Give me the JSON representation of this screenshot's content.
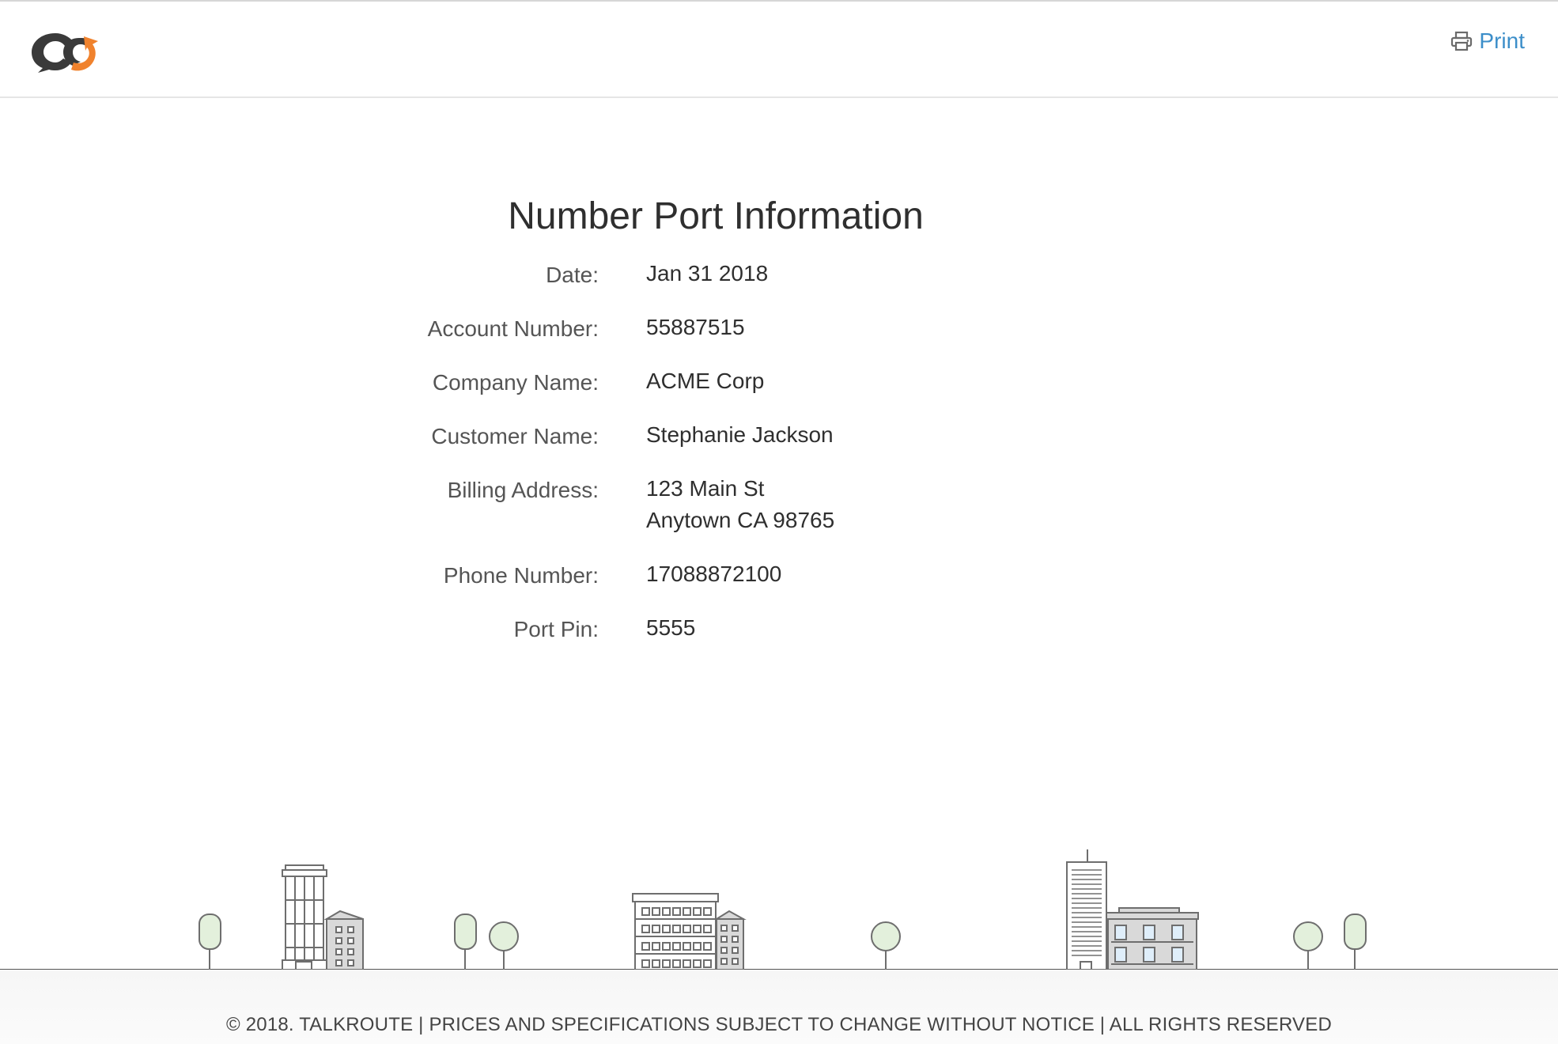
{
  "header": {
    "print_label": "Print"
  },
  "main": {
    "title": "Number Port Information",
    "fields": [
      {
        "label": "Date:",
        "lines": [
          "Jan 31 2018"
        ]
      },
      {
        "label": "Account Number:",
        "lines": [
          "55887515"
        ]
      },
      {
        "label": "Company Name:",
        "lines": [
          "ACME Corp"
        ]
      },
      {
        "label": "Customer Name:",
        "lines": [
          "Stephanie Jackson"
        ]
      },
      {
        "label": "Billing Address:",
        "lines": [
          "123 Main St",
          "Anytown CA 98765"
        ]
      },
      {
        "label": "Phone Number:",
        "lines": [
          "17088872100"
        ]
      },
      {
        "label": "Port Pin:",
        "lines": [
          "5555"
        ]
      }
    ]
  },
  "footer": {
    "text": "© 2018. TALKROUTE | PRICES AND SPECIFICATIONS SUBJECT TO CHANGE WITHOUT NOTICE | ALL RIGHTS RESERVED"
  },
  "icons": {
    "logo": "talkroute-logo-icon",
    "print": "printer-icon"
  },
  "colors": {
    "link": "#3c8ec9",
    "logo_dark": "#3a3a3a",
    "logo_accent": "#f0822d",
    "tree_fill": "#e3f0dc",
    "building_fill": "#d9d9d9"
  }
}
